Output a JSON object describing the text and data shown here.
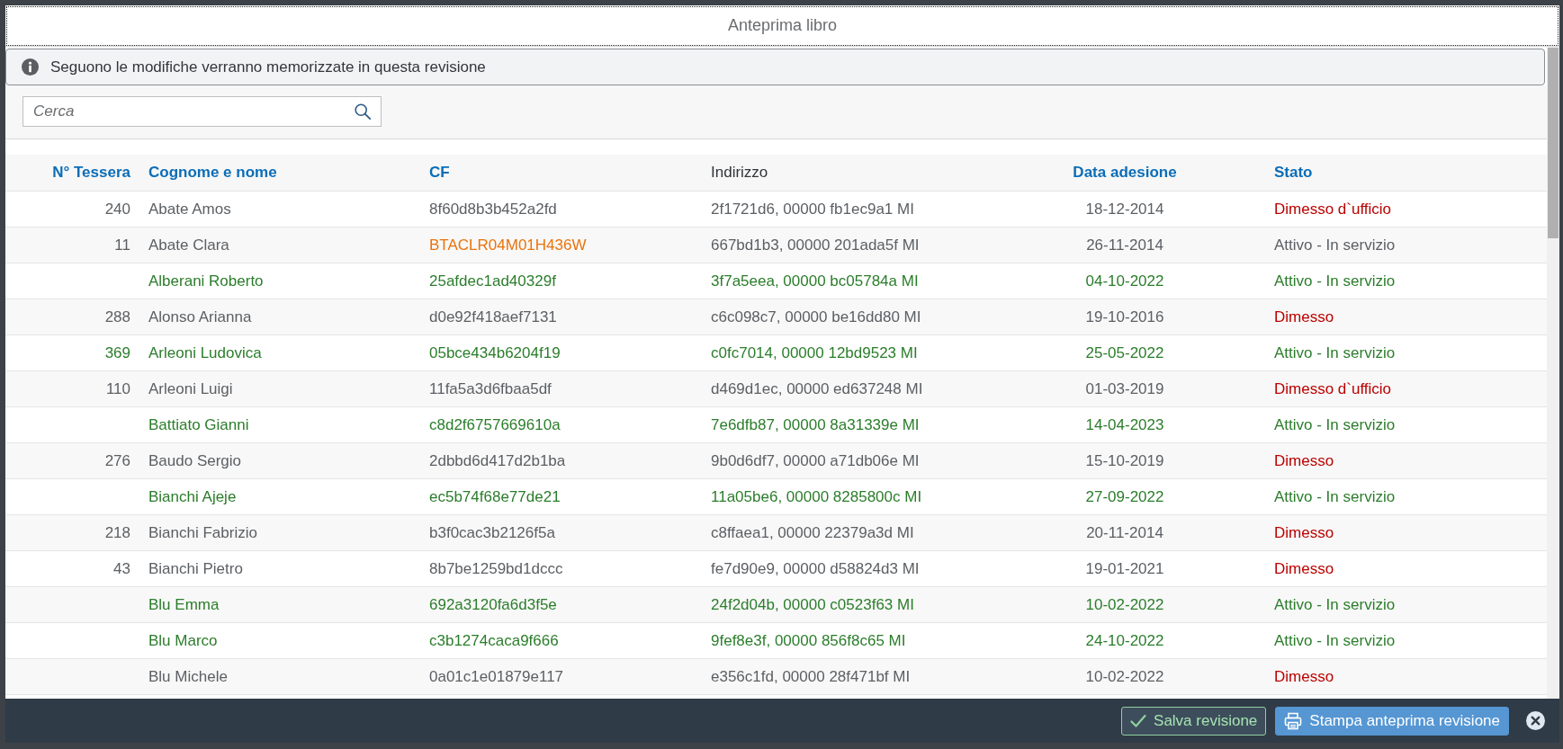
{
  "dialog": {
    "title": "Anteprima libro"
  },
  "info_banner": {
    "message": "Seguono le modifiche verranno memorizzate in questa revisione"
  },
  "search": {
    "placeholder": "Cerca"
  },
  "table": {
    "columns": [
      {
        "label": "N° Tessera",
        "sortable": true
      },
      {
        "label": "Cognome e nome",
        "sortable": true
      },
      {
        "label": "CF",
        "sortable": true
      },
      {
        "label": "Indirizzo",
        "sortable": false
      },
      {
        "label": "Data adesione",
        "sortable": true
      },
      {
        "label": "Stato",
        "sortable": true
      }
    ],
    "rows": [
      {
        "tessera": "240",
        "name": "Abate Amos",
        "cf": "8f60d8b3b452a2fd",
        "address": "2f1721d6, 00000 fb1ec9a1 MI",
        "date": "18-12-2014",
        "status": "Dimesso d`ufficio",
        "added": false,
        "cf_changed": false,
        "dismissed": true
      },
      {
        "tessera": "11",
        "name": "Abate Clara",
        "cf": "BTACLR04M01H436W",
        "address": "667bd1b3, 00000 201ada5f MI",
        "date": "26-11-2014",
        "status": "Attivo - In servizio",
        "added": false,
        "cf_changed": true,
        "dismissed": false
      },
      {
        "name": "Alberani Roberto",
        "cf": "25afdec1ad40329f",
        "address": "3f7a5eea, 00000 bc05784a MI",
        "date": "04-10-2022",
        "status": "Attivo - In servizio",
        "added": true,
        "cf_changed": false,
        "dismissed": false
      },
      {
        "tessera": "288",
        "name": "Alonso Arianna",
        "cf": "d0e92f418aef7131",
        "address": "c6c098c7, 00000 be16dd80 MI",
        "date": "19-10-2016",
        "status": "Dimesso",
        "added": false,
        "cf_changed": false,
        "dismissed": true
      },
      {
        "tessera": "369",
        "name": "Arleoni Ludovica",
        "cf": "05bce434b6204f19",
        "address": "c0fc7014, 00000 12bd9523 MI",
        "date": "25-05-2022",
        "status": "Attivo - In servizio",
        "added": true,
        "cf_changed": false,
        "dismissed": false
      },
      {
        "tessera": "110",
        "name": "Arleoni Luigi",
        "cf": "11fa5a3d6fbaa5df",
        "address": "d469d1ec, 00000 ed637248 MI",
        "date": "01-03-2019",
        "status": "Dimesso d`ufficio",
        "added": false,
        "cf_changed": false,
        "dismissed": true
      },
      {
        "name": "Battiato Gianni",
        "cf": "c8d2f6757669610a",
        "address": "7e6dfb87, 00000 8a31339e MI",
        "date": "14-04-2023",
        "status": "Attivo - In servizio",
        "added": true,
        "cf_changed": false,
        "dismissed": false
      },
      {
        "tessera": "276",
        "name": "Baudo Sergio",
        "cf": "2dbbd6d417d2b1ba",
        "address": "9b0d6df7, 00000 a71db06e MI",
        "date": "15-10-2019",
        "status": "Dimesso",
        "added": false,
        "cf_changed": false,
        "dismissed": true
      },
      {
        "name": "Bianchi Ajeje",
        "cf": "ec5b74f68e77de21",
        "address": "11a05be6, 00000 8285800c MI",
        "date": "27-09-2022",
        "status": "Attivo - In servizio",
        "added": true,
        "cf_changed": false,
        "dismissed": false
      },
      {
        "tessera": "218",
        "name": "Bianchi Fabrizio",
        "cf": "b3f0cac3b2126f5a",
        "address": "c8ffaea1, 00000 22379a3d MI",
        "date": "20-11-2014",
        "status": "Dimesso",
        "added": false,
        "cf_changed": false,
        "dismissed": true
      },
      {
        "tessera": "43",
        "name": "Bianchi Pietro",
        "cf": "8b7be1259bd1dccc",
        "address": "fe7d90e9, 00000 d58824d3 MI",
        "date": "19-01-2021",
        "status": "Dimesso",
        "added": false,
        "cf_changed": false,
        "dismissed": true
      },
      {
        "name": "Blu Emma",
        "cf": "692a3120fa6d3f5e",
        "address": "24f2d04b, 00000 c0523f63 MI",
        "date": "10-02-2022",
        "status": "Attivo - In servizio",
        "added": true,
        "cf_changed": false,
        "dismissed": false
      },
      {
        "name": "Blu Marco",
        "cf": "c3b1274caca9f666",
        "address": "9fef8e3f, 00000 856f8c65 MI",
        "date": "24-10-2022",
        "status": "Attivo - In servizio",
        "added": true,
        "cf_changed": false,
        "dismissed": false
      },
      {
        "name": "Blu Michele",
        "cf": "0a01c1e01879e117",
        "address": "e356c1fd, 00000 28f471bf MI",
        "date": "10-02-2022",
        "status": "Dimesso",
        "added": false,
        "cf_changed": false,
        "dismissed": true
      }
    ]
  },
  "footer": {
    "buttons": [
      {
        "label": "Salva revisione",
        "kind": "save"
      },
      {
        "label": "Stampa anteprima revisione",
        "kind": "print"
      }
    ]
  }
}
